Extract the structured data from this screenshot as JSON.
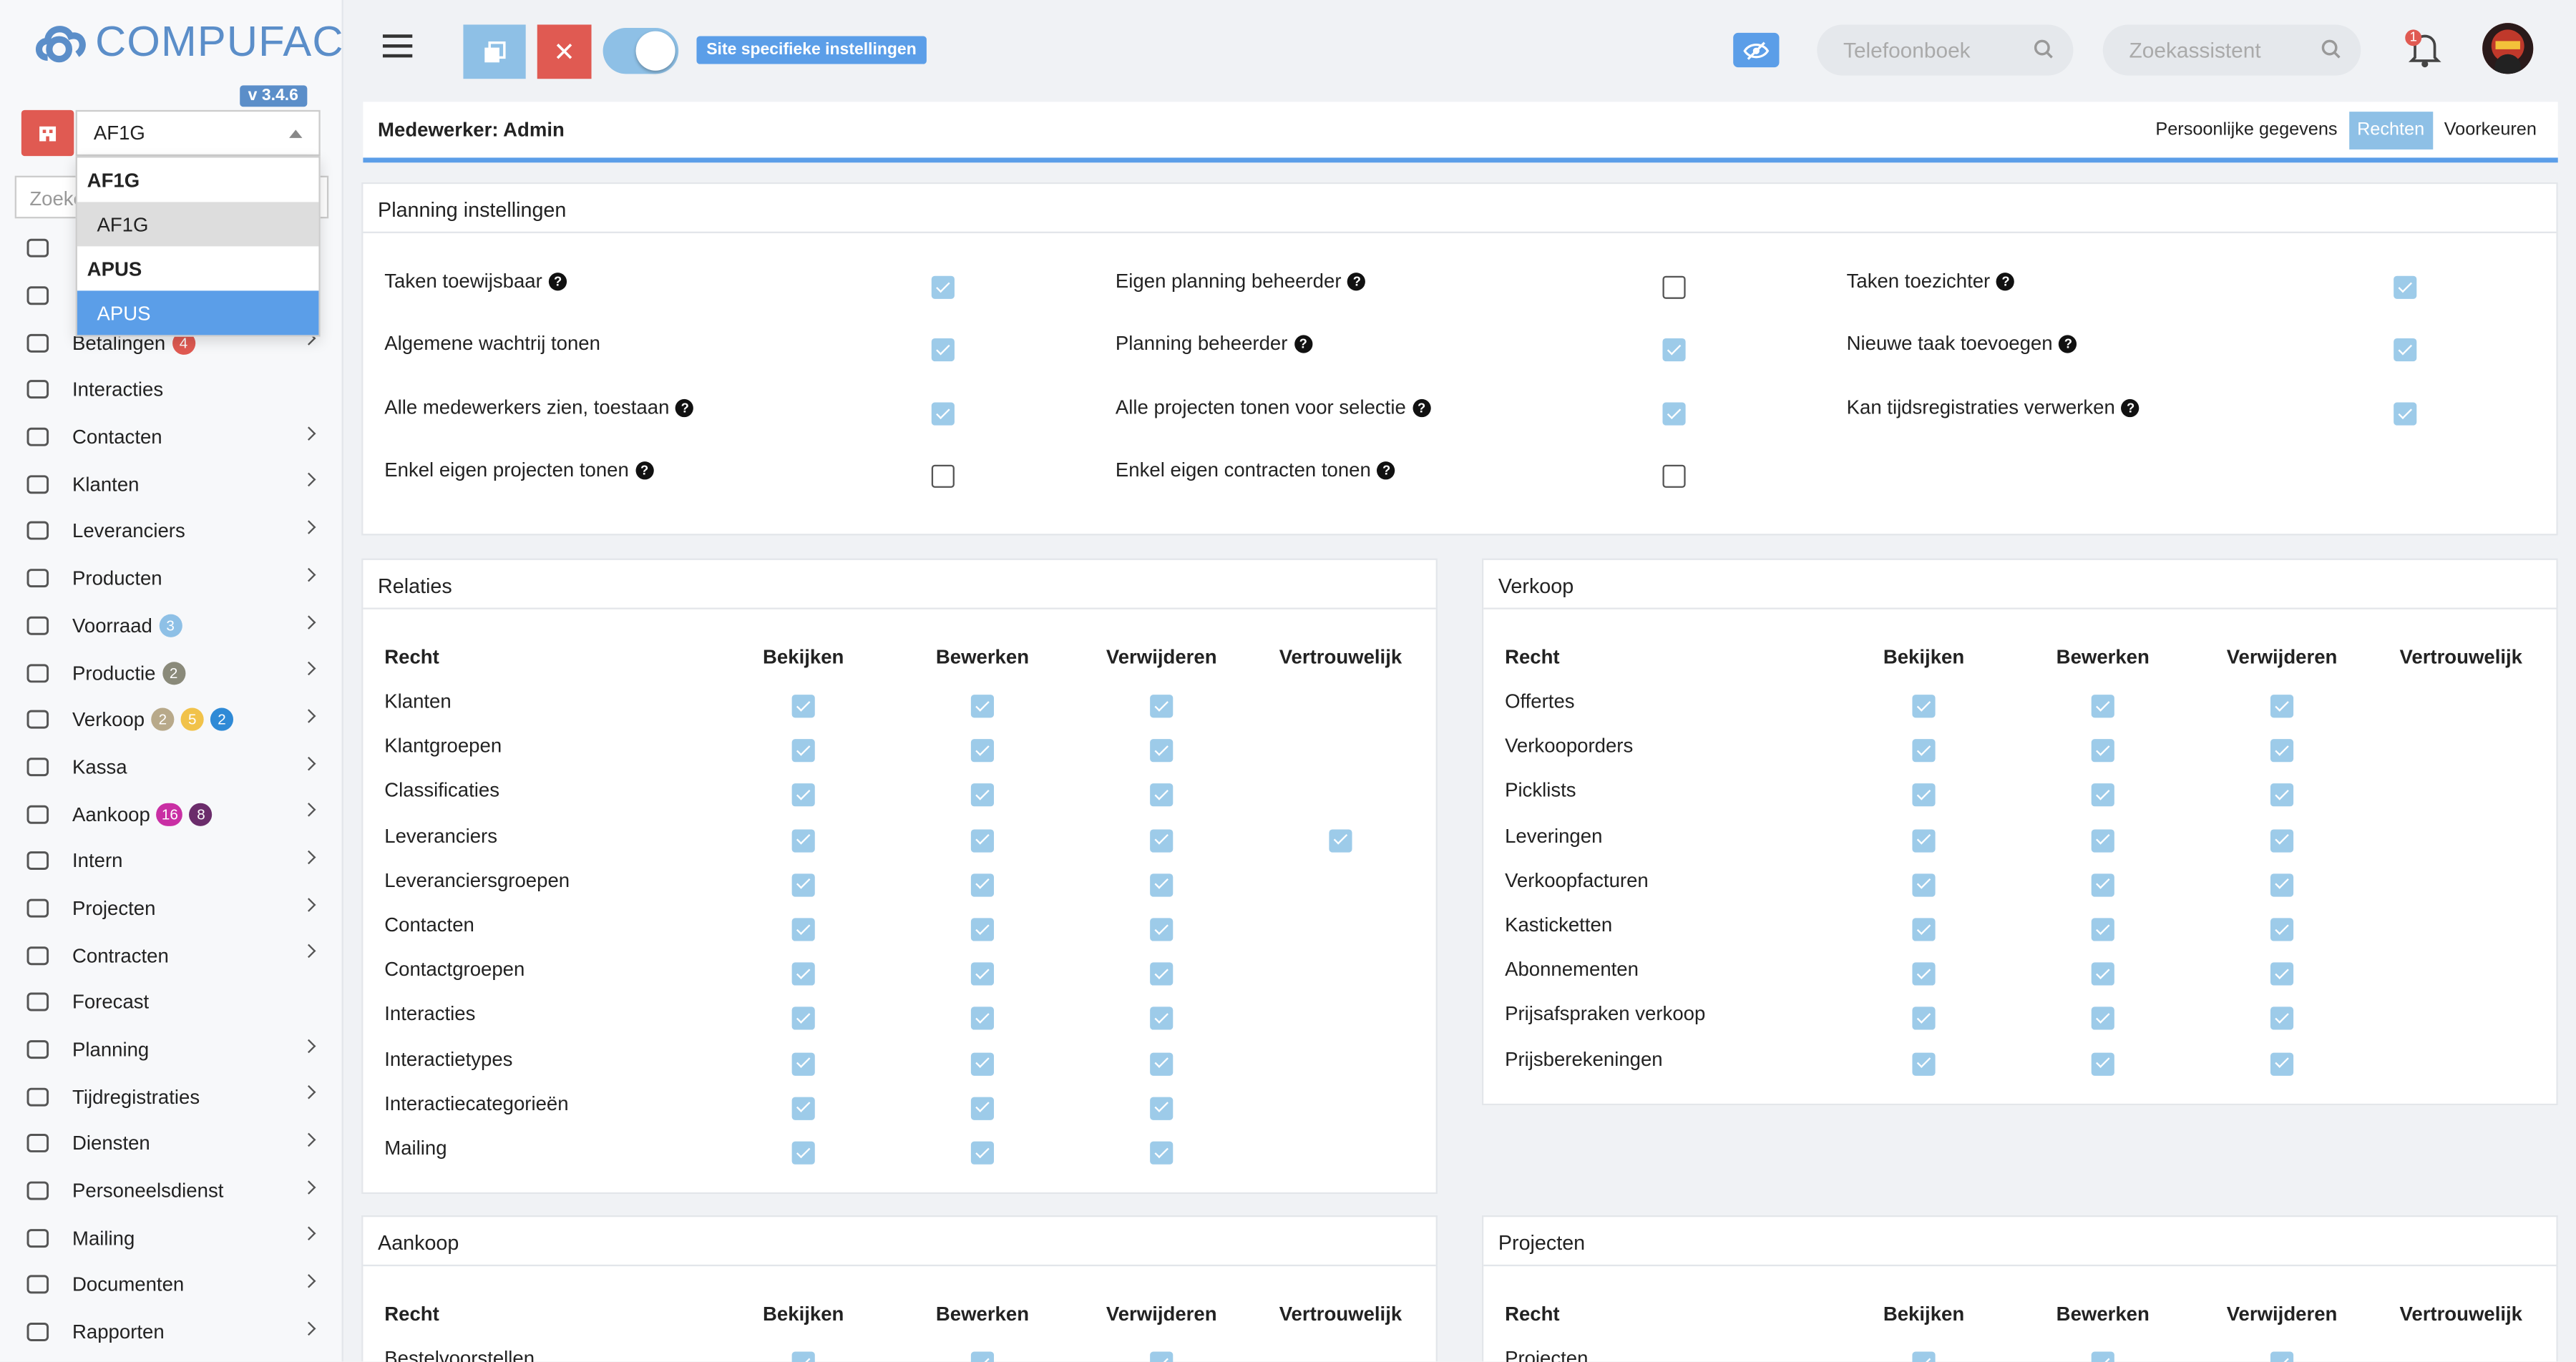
{
  "app": {
    "logo_text": "COMPUFACT",
    "version": "v 3.4.6"
  },
  "site_select": {
    "value": "AF1G"
  },
  "side_search": {
    "placeholder": "Zoeke"
  },
  "dropdown": [
    {
      "type": "group",
      "label": "AF1G"
    },
    {
      "type": "option",
      "label": "AF1G",
      "state": "hover"
    },
    {
      "type": "group",
      "label": "APUS"
    },
    {
      "type": "option",
      "label": "APUS",
      "state": "selected"
    }
  ],
  "nav": [
    {
      "label": "",
      "icon": "dashboard-icon",
      "chev": false,
      "badges": []
    },
    {
      "label": "",
      "icon": "user-check-icon",
      "chev": false,
      "badges": []
    },
    {
      "label": "Betalingen",
      "icon": "payments-icon",
      "chev": true,
      "badges": [
        {
          "v": "4",
          "c": "#e05a52"
        }
      ]
    },
    {
      "label": "Interacties",
      "icon": "chat-icon",
      "chev": false,
      "badges": []
    },
    {
      "label": "Contacten",
      "icon": "contact-card-icon",
      "chev": true,
      "badges": []
    },
    {
      "label": "Klanten",
      "icon": "customer-icon",
      "chev": true,
      "badges": []
    },
    {
      "label": "Leveranciers",
      "icon": "truck-icon",
      "chev": true,
      "badges": []
    },
    {
      "label": "Producten",
      "icon": "box-icon",
      "chev": true,
      "badges": []
    },
    {
      "label": "Voorraad",
      "icon": "stock-icon",
      "chev": true,
      "badges": [
        {
          "v": "3",
          "c": "#8ec0e6"
        }
      ]
    },
    {
      "label": "Productie",
      "icon": "cogs-icon",
      "chev": true,
      "badges": [
        {
          "v": "2",
          "c": "#8a8a7a"
        }
      ]
    },
    {
      "label": "Verkoop",
      "icon": "euro-icon",
      "chev": true,
      "badges": [
        {
          "v": "2",
          "c": "#b8a98a"
        },
        {
          "v": "5",
          "c": "#f1c24a"
        },
        {
          "v": "2",
          "c": "#2f8ad6"
        }
      ]
    },
    {
      "label": "Kassa",
      "icon": "basket-icon",
      "chev": true,
      "badges": []
    },
    {
      "label": "Aankoop",
      "icon": "cart-icon",
      "chev": true,
      "badges": [
        {
          "v": "16",
          "c": "#c92fa4"
        },
        {
          "v": "8",
          "c": "#6b2c6b"
        }
      ]
    },
    {
      "label": "Intern",
      "icon": "users-icon",
      "chev": true,
      "badges": []
    },
    {
      "label": "Projecten",
      "icon": "project-icon",
      "chev": true,
      "badges": []
    },
    {
      "label": "Contracten",
      "icon": "contract-icon",
      "chev": true,
      "badges": []
    },
    {
      "label": "Forecast",
      "icon": "forecast-icon",
      "chev": false,
      "badges": []
    },
    {
      "label": "Planning",
      "icon": "calendar-icon",
      "chev": true,
      "badges": []
    },
    {
      "label": "Tijdregistraties",
      "icon": "clock-icon",
      "chev": true,
      "badges": []
    },
    {
      "label": "Diensten",
      "icon": "refresh-icon",
      "chev": true,
      "badges": []
    },
    {
      "label": "Personeelsdienst",
      "icon": "personnel-icon",
      "chev": true,
      "badges": []
    },
    {
      "label": "Mailing",
      "icon": "send-icon",
      "chev": true,
      "badges": []
    },
    {
      "label": "Documenten",
      "icon": "folder-icon",
      "chev": true,
      "badges": []
    },
    {
      "label": "Rapporten",
      "icon": "chart-line-icon",
      "chev": true,
      "badges": []
    }
  ],
  "header": {
    "site_tag": "Site specifieke instellingen",
    "phonebook_placeholder": "Telefoonboek",
    "assistant_placeholder": "Zoekassistent",
    "notif_count": "1"
  },
  "employee": {
    "title": "Medewerker: Admin",
    "tabs": [
      {
        "label": "Persoonlijke gegevens",
        "active": false
      },
      {
        "label": "Rechten",
        "active": true
      },
      {
        "label": "Voorkeuren",
        "active": false
      }
    ]
  },
  "planning": {
    "title": "Planning instellingen",
    "columns": [
      [
        {
          "label": "Taken toewijsbaar",
          "help": true,
          "checked": true
        },
        {
          "label": "Algemene wachtrij tonen",
          "help": false,
          "checked": true
        },
        {
          "label": "Alle medewerkers zien, toestaan",
          "help": true,
          "checked": true
        },
        {
          "label": "Enkel eigen projecten tonen",
          "help": true,
          "checked": false
        }
      ],
      [
        {
          "label": "Eigen planning beheerder",
          "help": true,
          "checked": false
        },
        {
          "label": "Planning beheerder",
          "help": true,
          "checked": true
        },
        {
          "label": "Alle projecten tonen voor selectie",
          "help": true,
          "checked": true
        },
        {
          "label": "Enkel eigen contracten tonen",
          "help": true,
          "checked": false
        }
      ],
      [
        {
          "label": "Taken toezichter",
          "help": true,
          "checked": true
        },
        {
          "label": "Nieuwe taak toevoegen",
          "help": true,
          "checked": true
        },
        {
          "label": "Kan tijdsregistraties verwerken",
          "help": true,
          "checked": true
        }
      ]
    ]
  },
  "rights_headers": [
    "Recht",
    "Bekijken",
    "Bewerken",
    "Verwijderen",
    "Vertrouwelijk"
  ],
  "relaties": {
    "title": "Relaties",
    "rows": [
      {
        "name": "Klanten",
        "v": [
          1,
          1,
          1,
          null
        ]
      },
      {
        "name": "Klantgroepen",
        "v": [
          1,
          1,
          1,
          null
        ]
      },
      {
        "name": "Classificaties",
        "v": [
          1,
          1,
          1,
          null
        ]
      },
      {
        "name": "Leveranciers",
        "v": [
          1,
          1,
          1,
          1
        ]
      },
      {
        "name": "Leveranciersgroepen",
        "v": [
          1,
          1,
          1,
          null
        ]
      },
      {
        "name": "Contacten",
        "v": [
          1,
          1,
          1,
          null
        ]
      },
      {
        "name": "Contactgroepen",
        "v": [
          1,
          1,
          1,
          null
        ]
      },
      {
        "name": "Interacties",
        "v": [
          1,
          1,
          1,
          null
        ]
      },
      {
        "name": "Interactietypes",
        "v": [
          1,
          1,
          1,
          null
        ]
      },
      {
        "name": "Interactiecategorieën",
        "v": [
          1,
          1,
          1,
          null
        ]
      },
      {
        "name": "Mailing",
        "v": [
          1,
          1,
          1,
          null
        ]
      }
    ]
  },
  "verkoop": {
    "title": "Verkoop",
    "rows": [
      {
        "name": "Offertes",
        "v": [
          1,
          1,
          1,
          null
        ]
      },
      {
        "name": "Verkooporders",
        "v": [
          1,
          1,
          1,
          null
        ]
      },
      {
        "name": "Picklists",
        "v": [
          1,
          1,
          1,
          null
        ]
      },
      {
        "name": "Leveringen",
        "v": [
          1,
          1,
          1,
          null
        ]
      },
      {
        "name": "Verkoopfacturen",
        "v": [
          1,
          1,
          1,
          null
        ]
      },
      {
        "name": "Kasticketten",
        "v": [
          1,
          1,
          1,
          null
        ]
      },
      {
        "name": "Abonnementen",
        "v": [
          1,
          1,
          1,
          null
        ]
      },
      {
        "name": "Prijsafspraken verkoop",
        "v": [
          1,
          1,
          1,
          null
        ]
      },
      {
        "name": "Prijsberekeningen",
        "v": [
          1,
          1,
          1,
          null
        ]
      }
    ]
  },
  "aankoop": {
    "title": "Aankoop",
    "rows": [
      {
        "name": "Bestelvoorstellen",
        "v": [
          1,
          1,
          1,
          null
        ]
      }
    ]
  },
  "projecten": {
    "title": "Projecten",
    "rows": [
      {
        "name": "Projecten",
        "v": [
          1,
          1,
          1,
          null
        ]
      }
    ]
  }
}
